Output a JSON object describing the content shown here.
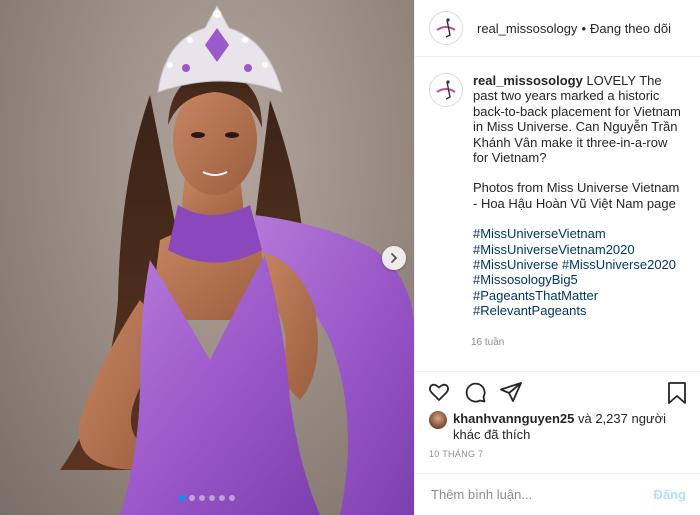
{
  "header": {
    "username": "real_missosology",
    "separator": "•",
    "follow_status": "Đang theo dõi"
  },
  "caption": {
    "username": "real_missosology",
    "text": "LOVELY The past two years marked a historic back-to-back placement for Vietnam in Miss Universe. Can Nguyễn Trần Khánh Vân make it three-in-a-row for Vietnam?",
    "credit": "Photos from Miss Universe Vietnam - Hoa Hậu Hoàn Vũ Việt Nam page",
    "hashtags": [
      "#MissUniverseVietnam",
      "#MissUniverseVietnam2020",
      "#MissUniverse #MissUniverse2020",
      "#MissosologyBig5",
      "#PageantsThatMatter",
      "#RelevantPageants"
    ],
    "time_ago": "16 tuần"
  },
  "likes": {
    "user": "khanhvannguyen25",
    "rest": " và 2,237 người khác đã thích"
  },
  "date": "10 THÁNG 7",
  "comment": {
    "placeholder": "Thêm bình luận...",
    "post_label": "Đăng"
  },
  "carousel": {
    "slides": 6,
    "active_index": 0
  },
  "icons": [
    "next-arrow-icon",
    "heart-icon",
    "comment-icon",
    "share-icon",
    "bookmark-icon"
  ],
  "colors": {
    "dress": "#9b59c9",
    "link": "#00376b",
    "post_disabled": "#b2dffc",
    "active_dot": "#0095f6"
  }
}
